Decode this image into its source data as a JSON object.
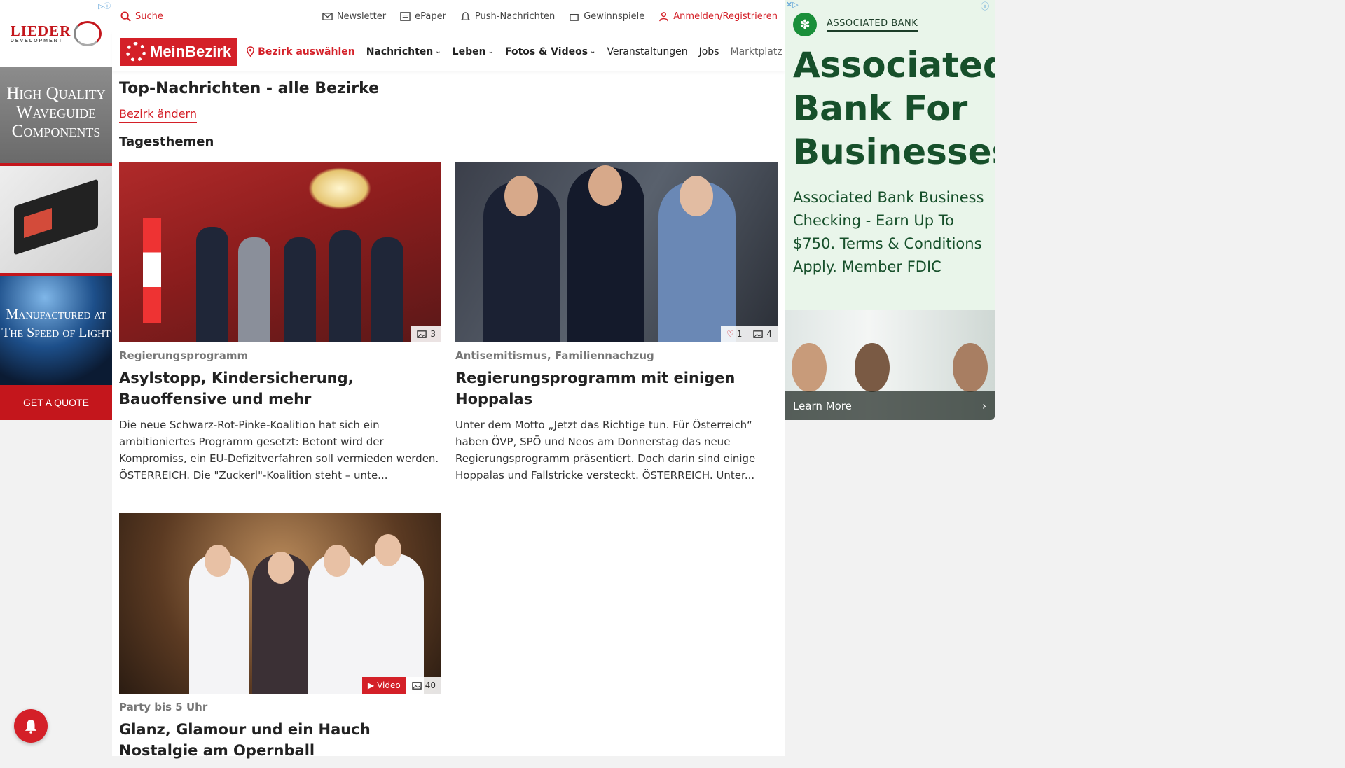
{
  "left_ad": {
    "ad_mark": "▷ⓘ",
    "brand": "LIEDER",
    "brand_sub": "DEVELOPMENT",
    "headline": "High Quality Waveguide Components",
    "tagline": "Manufactured at The Speed of Light",
    "cta": "GET A QUOTE"
  },
  "utility": {
    "search": "Suche",
    "newsletter": "Newsletter",
    "epaper": "ePaper",
    "push": "Push-Nachrichten",
    "games": "Gewinnspiele",
    "login": "Anmelden/Registrieren"
  },
  "nav": {
    "logo": "MeinBezirk",
    "district": "Bezirk auswählen",
    "items": [
      "Nachrichten",
      "Leben",
      "Fotos & Videos",
      "Veranstaltungen",
      "Jobs",
      "Marktplatz"
    ]
  },
  "page": {
    "title": "Top-Nachrichten - alle Bezirke",
    "change_district": "Bezirk ändern",
    "section": "Tagesthemen"
  },
  "articles": [
    {
      "kicker": "Regierungsprogramm",
      "title": "Asylstopp, Kindersicherung, Bauoffensive und mehr",
      "teaser": "Die neue Schwarz-Rot-Pinke-Koalition hat sich ein ambitioniertes Programm gesetzt: Betont wird der Kompromiss, ein EU-Defizitverfahren soll vermieden werden.  ÖSTERREICH. Die \"Zuckerl\"-Koalition steht – unte...",
      "photos": "3"
    },
    {
      "kicker": "Antisemitismus, Familiennachzug",
      "title": "Regierungsprogramm mit einigen Hoppalas",
      "teaser": "Unter dem Motto „Jetzt das Richtige tun. Für Österreich“ haben ÖVP, SPÖ und Neos am Donnerstag das neue Regierungsprogramm präsentiert. Doch darin sind einige Hoppalas und Fallstricke versteckt. ÖSTERREICH. Unter...",
      "likes": "1",
      "photos": "4"
    },
    {
      "kicker": "Party bis 5 Uhr",
      "title": "Glanz, Glamour und ein Hauch Nostalgie am Opernball",
      "video_label": "Video",
      "photos": "40"
    }
  ],
  "right_ad": {
    "advertiser": "ASSOCIATED BANK",
    "title": "Associated Bank For Businesses",
    "body": "Associated Bank Business Checking - Earn Up To $750. Terms & Conditions Apply. Member FDIC",
    "cta": "Learn More"
  },
  "colors": {
    "brand_red": "#d42028",
    "ad_green": "#17502b",
    "ad_bg": "#e9f5ea"
  }
}
